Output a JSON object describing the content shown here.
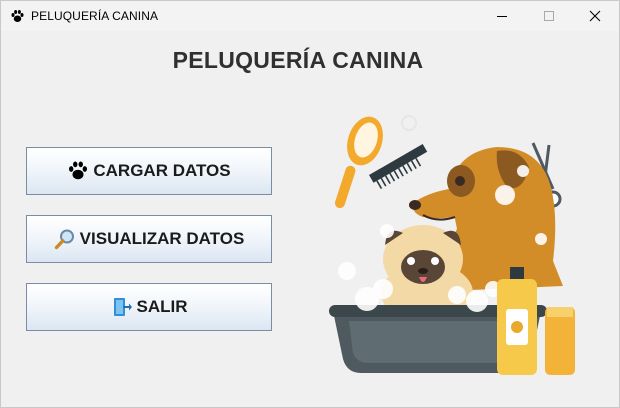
{
  "window": {
    "title": "PELUQUERÍA CANINA",
    "icon": "paw-icon"
  },
  "main": {
    "heading": "PELUQUERÍA CANINA",
    "buttons": [
      {
        "label": "CARGAR DATOS",
        "icon": "paw-icon"
      },
      {
        "label": "VISUALIZAR DATOS",
        "icon": "magnifier-icon"
      },
      {
        "label": "SALIR",
        "icon": "exit-door-icon"
      }
    ]
  },
  "illustration": {
    "subject": "dog-grooming",
    "accent": "#e8a92c",
    "tub": "#4e5a5f"
  }
}
